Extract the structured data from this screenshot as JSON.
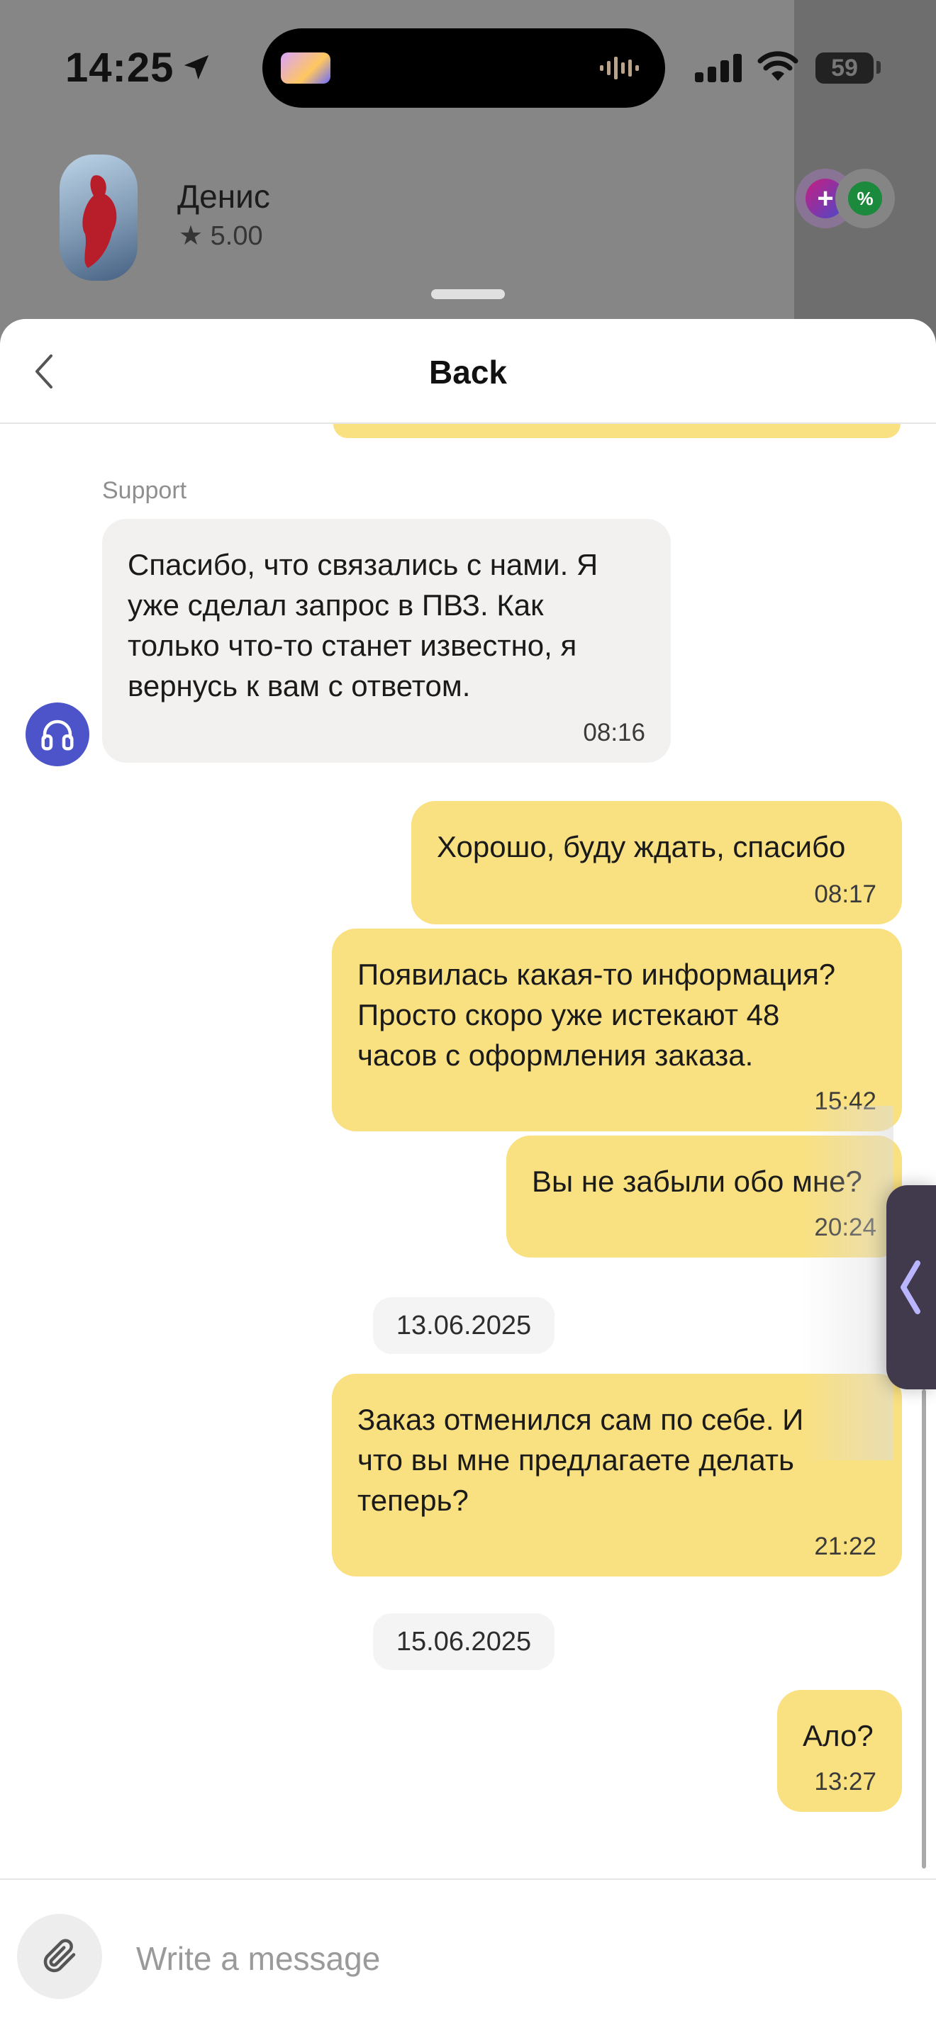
{
  "status_bar": {
    "time": "14:25",
    "battery": "59"
  },
  "background_ride": {
    "driver_name": "Денис",
    "driver_rating": "★ 5.00",
    "plus_badge": "+",
    "percent_badge": "%"
  },
  "header": {
    "title": "Back"
  },
  "messages": [
    {
      "sender_label": "Support",
      "direction": "in",
      "text": "Спасибо, что связались с нами. Я\nуже сделал запрос в ПВЗ. Как\nтолько что-то станет известно, я\nвернусь к вам с ответом.",
      "time": "08:16"
    },
    {
      "direction": "out",
      "text": "Хорошо, буду ждать, спасибо",
      "time": "08:17"
    },
    {
      "direction": "out",
      "text": "Появилась какая-то информация?\nПросто скоро уже истекают 48\nчасов с оформления заказа.",
      "time": "15:42"
    },
    {
      "direction": "out",
      "text": "Вы не забыли обо мне?",
      "time": "20:24"
    },
    {
      "direction": "out",
      "text": "Заказ отменился сам по себе. И\nчто вы мне предлагаете делать\nтеперь?",
      "time": "21:22"
    },
    {
      "direction": "out",
      "text": "Ало?",
      "time": "13:27"
    }
  ],
  "dates": [
    "13.06.2025",
    "15.06.2025"
  ],
  "composer": {
    "placeholder": "Write a message"
  },
  "colors": {
    "outgoing_bubble": "#f9e081",
    "incoming_bubble": "#f2f1ef",
    "support_avatar": "#4d54c9"
  }
}
